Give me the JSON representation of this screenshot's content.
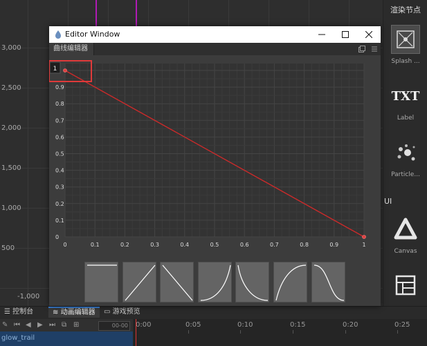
{
  "scene": {
    "y_labels": [
      "3,000",
      "2,500",
      "2,000",
      "1,500",
      "1,000",
      "500"
    ],
    "x_label": "-1,000"
  },
  "node_panel": {
    "title": "渲染节点",
    "nodes": [
      {
        "label": "Splash ...",
        "icon": "splash-icon"
      },
      {
        "label": "Label",
        "icon": "txt-icon",
        "glyph": "TXT"
      },
      {
        "label": "Particle...",
        "icon": "particle-icon"
      },
      {
        "label": "Canvas",
        "icon": "canvas-triangle-icon"
      },
      {
        "label": "",
        "icon": "layout-grid-icon"
      }
    ],
    "section_ui": "UI"
  },
  "editor_window": {
    "title": "Editor Window",
    "tab_label": "曲线编辑器",
    "value_badge": "1",
    "highlight_color": "#e03a3a",
    "curve_color": "#cc2a2a",
    "presets": [
      {
        "name": "constant"
      },
      {
        "name": "linear-up"
      },
      {
        "name": "linear-down"
      },
      {
        "name": "ease-in"
      },
      {
        "name": "ease-out-down"
      },
      {
        "name": "ease-out"
      },
      {
        "name": "ease-in-out-down"
      }
    ]
  },
  "chart_data": {
    "type": "line",
    "title": "",
    "xlabel": "",
    "ylabel": "",
    "xlim": [
      0,
      1
    ],
    "ylim": [
      0,
      1
    ],
    "x_ticks": [
      "0",
      "0.1",
      "0.2",
      "0.3",
      "0.4",
      "0.5",
      "0.6",
      "0.7",
      "0.8",
      "0.9",
      "1"
    ],
    "y_ticks": [
      "0",
      "0.1",
      "0.2",
      "0.3",
      "0.4",
      "0.5",
      "0.6",
      "0.7",
      "0.8",
      "0.9"
    ],
    "grid": true,
    "series": [
      {
        "x": [
          0,
          1
        ],
        "y": [
          1,
          0
        ]
      }
    ]
  },
  "bottom_panel": {
    "tabs": [
      {
        "label": "控制台",
        "icon": "console-icon"
      },
      {
        "label": "动画编辑器",
        "icon": "animation-icon"
      },
      {
        "label": "游戏预览",
        "icon": "game-preview-icon"
      }
    ],
    "frame_counter": "00-00",
    "track_name": "glow_trail",
    "time_ticks": [
      "0:00",
      "0:05",
      "0:10",
      "0:15",
      "0:20",
      "0:25"
    ],
    "accent_color": "#3b7fd4",
    "playhead_color": "#dd3333"
  }
}
